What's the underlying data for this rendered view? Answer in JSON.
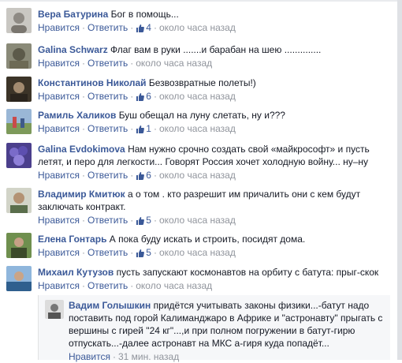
{
  "actions": {
    "like": "Нравится",
    "reply": "Ответить",
    "dot": "·"
  },
  "comments": [
    {
      "author": "Вера Батурина",
      "text": "Бог в помощь...",
      "likes": "4",
      "time": "около часа назад"
    },
    {
      "author": "Galina Schwarz",
      "text": "Флаг вам в руки .......и барабан на шею ..............",
      "likes": "",
      "time": "около часа назад"
    },
    {
      "author": "Константинов Николай",
      "text": "Безвозвратные полеты!)",
      "likes": "6",
      "time": "около часа назад"
    },
    {
      "author": "Рамиль Халиков",
      "text": "Буш обещал на луну слетать, ну и???",
      "likes": "1",
      "time": "около часа назад"
    },
    {
      "author": "Galina Evdokimova",
      "text": "Нам нужно срочно создать свой «майкрософт» и пусть летят, и перо для легкости... Говорят Россия хочет холодную войну... ну–ну",
      "likes": "6",
      "time": "около часа назад"
    },
    {
      "author": "Владимир Кмитюк",
      "text": "а о том . кто разрешит им причалить они с кем будут заключать контракт.",
      "likes": "5",
      "time": "около часа назад"
    },
    {
      "author": "Елена Гонтарь",
      "text": "А пока буду искать и строить, посидят дома.",
      "likes": "5",
      "time": "около часа назад"
    },
    {
      "author": "Михаил Кутузов",
      "text": "пусть запускают космонавтов на орбиту с батута: прыг-скок",
      "likes": "",
      "time": "около часа назад"
    }
  ],
  "reply": {
    "author": "Вадим Голышкин",
    "text": "придётся учитывать законы физики...-батут надо поставить под горой Калиманджаро в Африке и \"астронавту\" прыгать с вершины с гирей \"24 кг\"...,и при полном погружении в батут-гирю отпускать...-далее астронавт на МКС а-гиря куда попадёт...",
    "time": "31 мин. назад"
  }
}
